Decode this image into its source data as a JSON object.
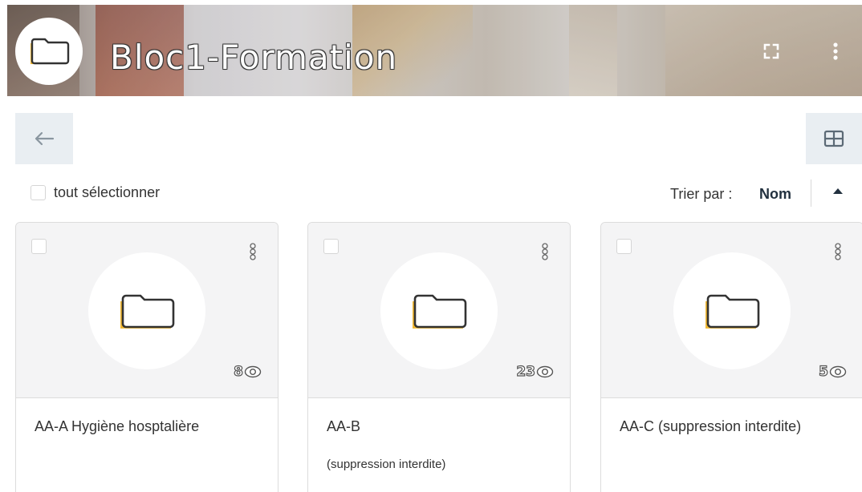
{
  "banner": {
    "title": "Bloc1-Formation",
    "folder_icon": "folder-icon",
    "fullscreen_icon": "fullscreen-icon",
    "menu_icon": "more-vertical-icon"
  },
  "toolbar": {
    "back_icon": "arrow-left-icon",
    "view_icon": "grid-view-icon"
  },
  "selection": {
    "select_all_label": "tout sélectionner"
  },
  "sort": {
    "label": "Trier par :",
    "value": "Nom",
    "direction_icon": "caret-up-icon"
  },
  "colors": {
    "folder_accent": "#f1b934",
    "folder_outline": "#333333",
    "button_bg": "#e9eef2"
  },
  "cards": [
    {
      "title": "AA-A Hygiène hosptalière",
      "subtitle": "",
      "views": "8"
    },
    {
      "title": "AA-B",
      "subtitle": "(suppression interdite)",
      "views": "23"
    },
    {
      "title": "AA-C (suppression interdite)",
      "subtitle": "",
      "views": "5"
    }
  ]
}
